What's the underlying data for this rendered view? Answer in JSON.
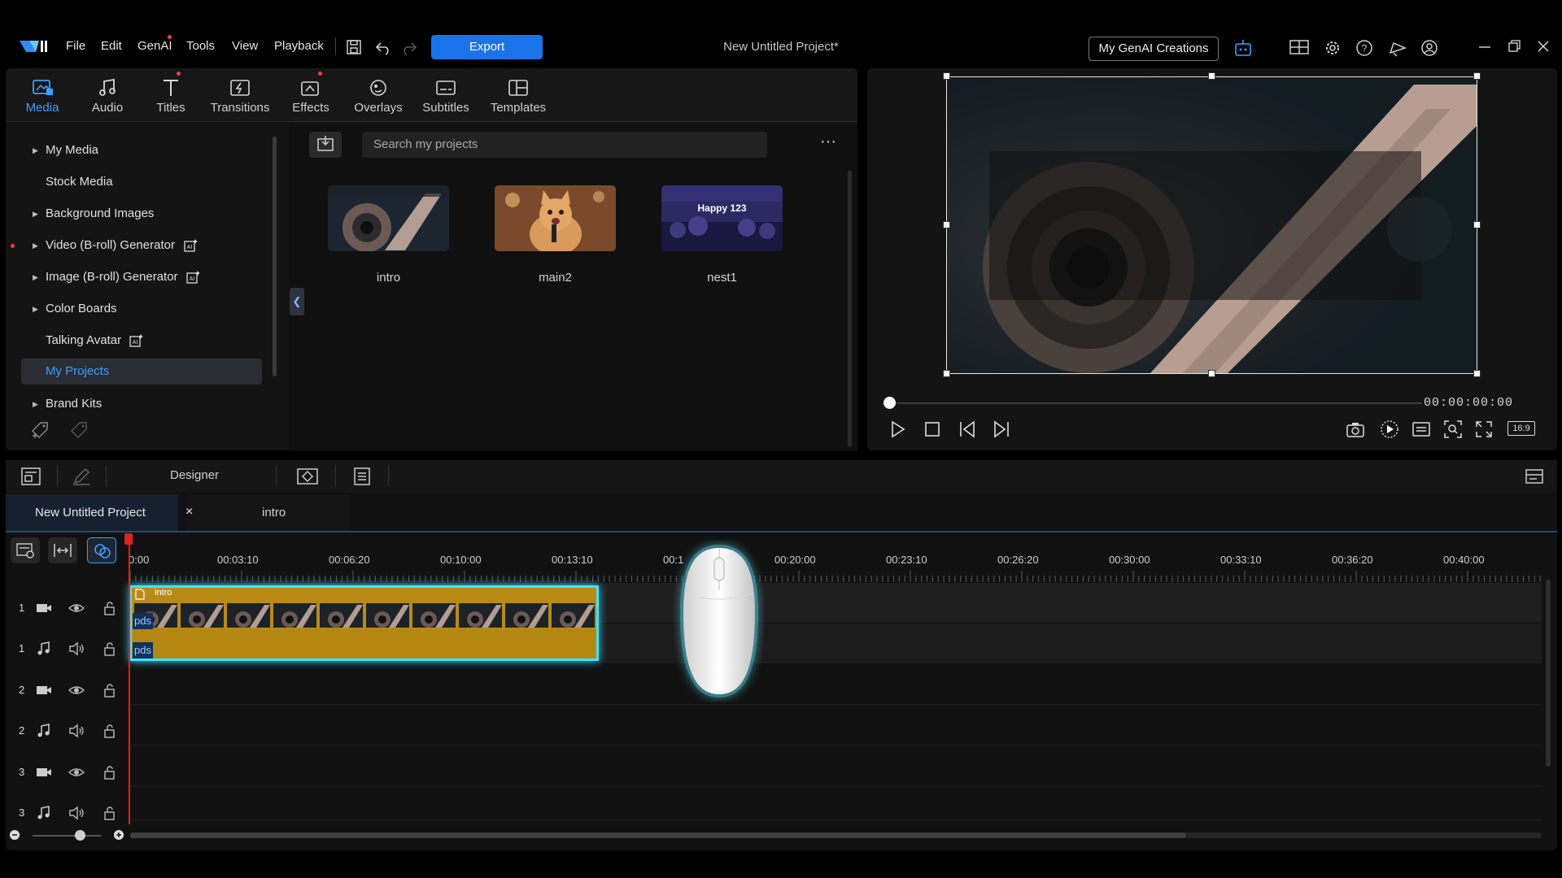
{
  "menu": {
    "file": "File",
    "edit": "Edit",
    "genai": "GenAI",
    "tools": "Tools",
    "view": "View",
    "playback": "Playback",
    "export": "Export",
    "project_title": "New Untitled Project*",
    "genai_creations": "My GenAI Creations"
  },
  "tabs": [
    {
      "label": "Media",
      "icon": "media-icon"
    },
    {
      "label": "Audio",
      "icon": "music-note-icon"
    },
    {
      "label": "Titles",
      "icon": "title-t-icon"
    },
    {
      "label": "Transitions",
      "icon": "transition-icon"
    },
    {
      "label": "Effects",
      "icon": "effects-icon"
    },
    {
      "label": "Overlays",
      "icon": "overlays-icon"
    },
    {
      "label": "Subtitles",
      "icon": "subtitles-icon"
    },
    {
      "label": "Templates",
      "icon": "templates-icon"
    }
  ],
  "library": {
    "tree": [
      {
        "label": "My Media",
        "arrow": "▶"
      },
      {
        "label": "Stock Media",
        "arrow": ""
      },
      {
        "label": "Background Images",
        "arrow": "▶"
      },
      {
        "label": "Video (B-roll) Generator",
        "arrow": "▶"
      },
      {
        "label": "Image (B-roll) Generator",
        "arrow": "▶"
      },
      {
        "label": "Color Boards",
        "arrow": "▶"
      },
      {
        "label": "Talking Avatar",
        "arrow": ""
      },
      {
        "label": "My Projects",
        "arrow": ""
      },
      {
        "label": "Brand Kits",
        "arrow": "▶"
      }
    ],
    "search_placeholder": "Search my projects",
    "more": "···",
    "items": [
      {
        "label": "intro"
      },
      {
        "label": "main2"
      },
      {
        "label": "nest1",
        "overlay": "Happy 123"
      }
    ]
  },
  "preview": {
    "timecode": "00:00:00:00",
    "aspect": "16:9"
  },
  "timeline": {
    "designer": "Designer",
    "project_tab": "New Untitled Project",
    "close": "×",
    "subtab": "intro",
    "ruler": [
      "0:00",
      "00:03:10",
      "00:06:20",
      "00:10:00",
      "00:13:10",
      "00:1",
      "00:20:00",
      "00:23:10",
      "00:26:20",
      "00:30:00",
      "00:33:10",
      "00:36:20",
      "00:40:00"
    ],
    "tracks": [
      {
        "num": "1",
        "type": "video"
      },
      {
        "num": "1",
        "type": "audio"
      },
      {
        "num": "2",
        "type": "video"
      },
      {
        "num": "2",
        "type": "audio"
      },
      {
        "num": "3",
        "type": "video"
      },
      {
        "num": "3",
        "type": "audio"
      }
    ],
    "clip": {
      "name": "intro",
      "badge": "pds"
    }
  },
  "colors": {
    "accent": "#1a73e8",
    "clip": "#b98b14",
    "selection": "#43e3ff",
    "playhead": "#dd2222"
  }
}
